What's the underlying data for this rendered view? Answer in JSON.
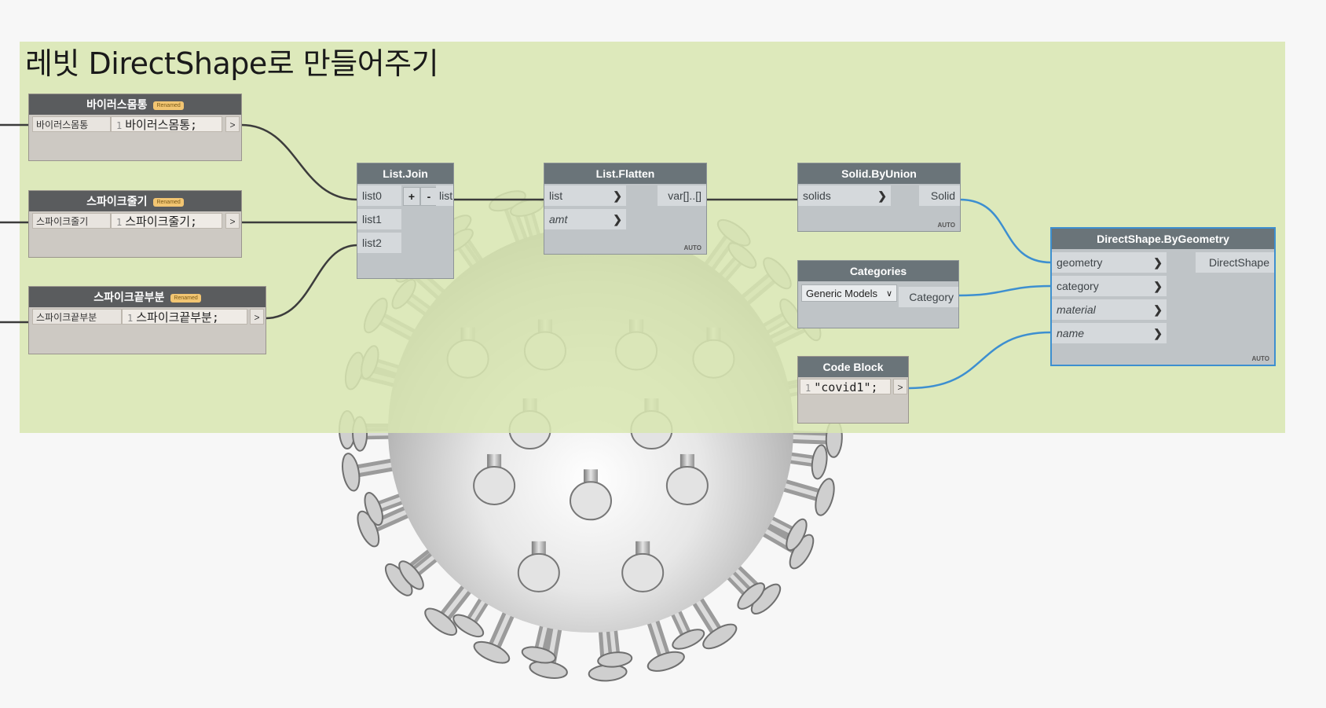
{
  "group": {
    "title": "레빗 DirectShape로 만들어주기",
    "color": "#d9e6b1"
  },
  "nodes": {
    "input1": {
      "title": "바이러스몸통",
      "badge": "Renamed",
      "name": "바이러스몸통",
      "line": "1",
      "code": "바이러스몸통;",
      "out": ">"
    },
    "input2": {
      "title": "스파이크줄기",
      "badge": "Renamed",
      "name": "스파이크줄기",
      "line": "1",
      "code": "스파이크줄기;",
      "out": ">"
    },
    "input3": {
      "title": "스파이크끝부분",
      "badge": "Renamed",
      "name": "스파이크끝부분",
      "line": "1",
      "code": "스파이크끝부분;",
      "out": ">"
    },
    "list_join": {
      "title": "List.Join",
      "inputs": [
        "list0",
        "list1",
        "list2"
      ],
      "plus": "+",
      "minus": "-",
      "output": "list"
    },
    "list_flatten": {
      "title": "List.Flatten",
      "inputs": [
        "list",
        "amt"
      ],
      "output": "var[]..[]",
      "lacing": "AUTO"
    },
    "solid_byunion": {
      "title": "Solid.ByUnion",
      "inputs": [
        "solids"
      ],
      "output": "Solid",
      "lacing": "AUTO"
    },
    "categories": {
      "title": "Categories",
      "selected": "Generic Models",
      "output": "Category"
    },
    "code_block": {
      "title": "Code Block",
      "line": "1",
      "code": "\"covid1\";",
      "out": ">"
    },
    "directshape": {
      "title": "DirectShape.ByGeometry",
      "inputs": [
        "geometry",
        "category",
        "material",
        "name"
      ],
      "output": "DirectShape",
      "lacing": "AUTO"
    }
  },
  "icons": {
    "port_arrow": "chevron-right-icon",
    "dropdown": "chevron-down-icon"
  },
  "colors": {
    "wire_default": "#3c3c3c",
    "wire_selected": "#3d8fd0",
    "node_header": "#6a7479",
    "input_header": "#5a5c5e"
  }
}
